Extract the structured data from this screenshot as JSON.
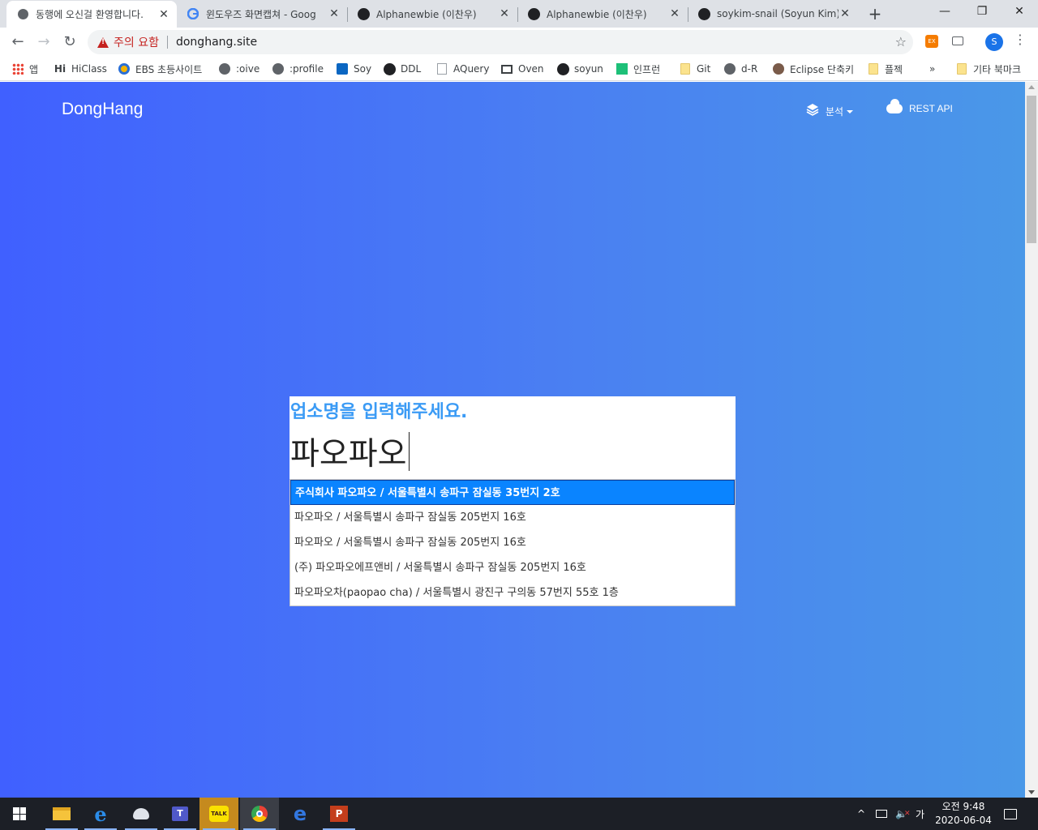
{
  "browser": {
    "tabs": [
      {
        "title": "동행에 오신걸 환영합니다.",
        "favicon": "globe-icon",
        "active": true
      },
      {
        "title": "윈도우즈 화면캡쳐 - Goog",
        "favicon": "google-icon",
        "active": false
      },
      {
        "title": "Alphanewbie (이찬우)",
        "favicon": "github-icon",
        "active": false
      },
      {
        "title": "Alphanewbie (이찬우)",
        "favicon": "github-icon",
        "active": false
      },
      {
        "title": "soykim-snail (Soyun Kim)",
        "favicon": "github-icon",
        "active": false
      }
    ],
    "new_tab": "+",
    "close_glyph": "✕",
    "window_controls": {
      "minimize": "—",
      "restore": "❐",
      "close": "✕"
    },
    "security_warning": "주의 요함",
    "url": "donghang.site",
    "profile_initial": "S",
    "extension_label": "EX"
  },
  "bookmarks": {
    "items": [
      {
        "label": "앱",
        "icon": "apps-icon"
      },
      {
        "label": "HiClass",
        "icon": "hiclass-icon"
      },
      {
        "label": "EBS 초등사이트",
        "icon": "ebs-icon"
      },
      {
        "label": ":oive",
        "icon": "globe-icon"
      },
      {
        "label": ":profile",
        "icon": "globe-icon"
      },
      {
        "label": "Soy",
        "icon": "linkedin-icon"
      },
      {
        "label": "DDL",
        "icon": "github-icon"
      },
      {
        "label": "AQuery",
        "icon": "page-icon"
      },
      {
        "label": "Oven",
        "icon": "oven-icon"
      },
      {
        "label": "soyun",
        "icon": "github-icon"
      },
      {
        "label": "인프런",
        "icon": "inflearn-icon"
      },
      {
        "label": "Git",
        "icon": "folder-icon"
      },
      {
        "label": "d-R",
        "icon": "globe-icon"
      },
      {
        "label": "Eclipse 단축키",
        "icon": "eclipse-icon"
      },
      {
        "label": "플젝",
        "icon": "folder-icon"
      }
    ],
    "overflow": "»",
    "other_bookmarks": "기타 북마크"
  },
  "page": {
    "brand": "DongHang",
    "nav": {
      "analysis_label": "분석",
      "rest_api_label": "REST API"
    },
    "search": {
      "prompt": "업소명을 입력해주세요.",
      "query": "파오파오"
    },
    "suggestions": [
      "주식회사 파오파오 / 서울특별시 송파구 잠실동 35번지 2호",
      "파오파오 / 서울특별시 송파구 잠실동 205번지 16호",
      "파오파오 / 서울특별시 송파구 잠실동 205번지 16호",
      "(주) 파오파오에프앤비 / 서울특별시 송파구 잠실동 205번지 16호",
      "파오파오차(paopao cha) / 서울특별시 광진구 구의동 57번지 55호 1층"
    ],
    "active_suggestion_index": 0
  },
  "taskbar": {
    "apps": [
      "file-explorer-icon",
      "internet-explorer-icon",
      "snipping-icon",
      "teams-icon",
      "kakaotalk-icon",
      "chrome-icon",
      "edge-icon",
      "powerpoint-icon"
    ],
    "tray": {
      "chevron": "^",
      "ime": "가"
    },
    "clock_time": "오전 9:48",
    "clock_date": "2020-06-04"
  },
  "colors": {
    "gradient_start": "#4060ff",
    "gradient_end": "#4a98e8",
    "prompt_blue": "#3b9bf5",
    "suggestion_active": "#0a84ff",
    "warning_red": "#c5221f"
  }
}
